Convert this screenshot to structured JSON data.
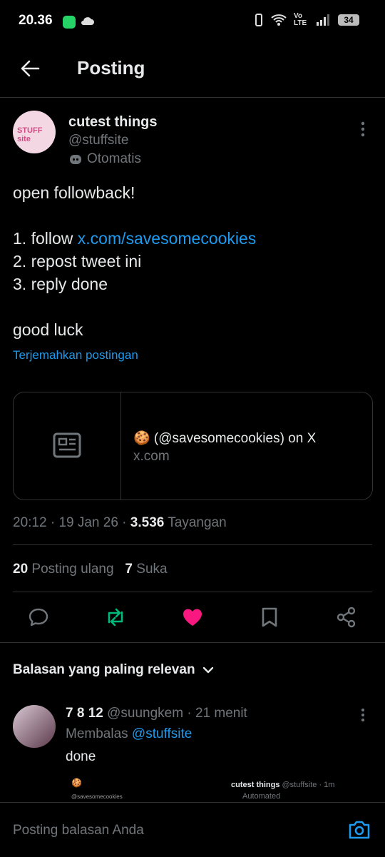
{
  "status_bar": {
    "time": "20.36",
    "battery": "34",
    "network": "Vo LTE"
  },
  "header": {
    "title": "Posting"
  },
  "post": {
    "avatar_text": "STUFF site",
    "author_name": "cutest things",
    "author_handle": "@stuffsite",
    "automated_label": "Otomatis",
    "text_line1": "open followback!",
    "text_step1_prefix": "1. follow ",
    "text_step1_link": "x.com/savesomecookies",
    "text_step2": "2. repost tweet ini",
    "text_step3": "3. reply done",
    "text_closing": "good luck",
    "translate_label": "Terjemahkan postingan",
    "card": {
      "title": "🍪 (@savesomecookies) on X",
      "domain": "x.com"
    },
    "time": "20:12",
    "date": "19 Jan 26",
    "views": "3.536",
    "views_label": "Tayangan",
    "reposts": "20",
    "reposts_label": "Posting ulang",
    "likes": "7",
    "likes_label": "Suka"
  },
  "replies": {
    "sort_label": "Balasan yang paling relevan",
    "items": [
      {
        "name": "7 8 12",
        "handle": "@suungkem",
        "time": "· 21 menit",
        "replying_prefix": "Membalas ",
        "replying_to": "@stuffsite",
        "text": "done",
        "embed": {
          "left_caption": "@savesomecookies",
          "right_name": "cutest things",
          "right_handle": "@stuffsite · 1m",
          "right_auto": "Automated"
        }
      }
    ]
  },
  "composer": {
    "placeholder": "Posting balasan Anda"
  },
  "colors": {
    "accent": "#1d9bf0",
    "like": "#f91880",
    "repost": "#00ba7c",
    "background": "#000000"
  }
}
